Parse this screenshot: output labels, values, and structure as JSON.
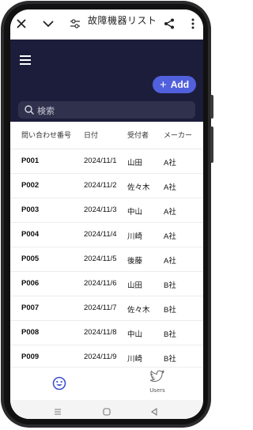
{
  "app": {
    "title": "故障機器リスト"
  },
  "header": {
    "add_label": "Add",
    "add_icon": "plus-icon"
  },
  "search": {
    "placeholder": "検索"
  },
  "table": {
    "columns": [
      "問い合わせ番号",
      "日付",
      "受付者",
      "メーカー"
    ],
    "rows": [
      {
        "id": "P001",
        "date": "2024/11/1",
        "receiver": "山田",
        "maker": "A社"
      },
      {
        "id": "P002",
        "date": "2024/11/2",
        "receiver": "佐々木",
        "maker": "A社"
      },
      {
        "id": "P003",
        "date": "2024/11/3",
        "receiver": "中山",
        "maker": "A社"
      },
      {
        "id": "P004",
        "date": "2024/11/4",
        "receiver": "川崎",
        "maker": "A社"
      },
      {
        "id": "P005",
        "date": "2024/11/5",
        "receiver": "後藤",
        "maker": "A社"
      },
      {
        "id": "P006",
        "date": "2024/11/6",
        "receiver": "山田",
        "maker": "B社"
      },
      {
        "id": "P007",
        "date": "2024/11/7",
        "receiver": "佐々木",
        "maker": "B社"
      },
      {
        "id": "P008",
        "date": "2024/11/8",
        "receiver": "中山",
        "maker": "B社"
      },
      {
        "id": "P009",
        "date": "2024/11/9",
        "receiver": "川崎",
        "maker": "B社"
      }
    ]
  },
  "bottom_nav": {
    "items": [
      {
        "icon": "smiley-icon",
        "label": ""
      },
      {
        "icon": "bird-icon",
        "label": "Users"
      }
    ]
  },
  "colors": {
    "header_bg": "#1c1d3a",
    "accent": "#5160dc",
    "search_bg": "#30314d"
  }
}
